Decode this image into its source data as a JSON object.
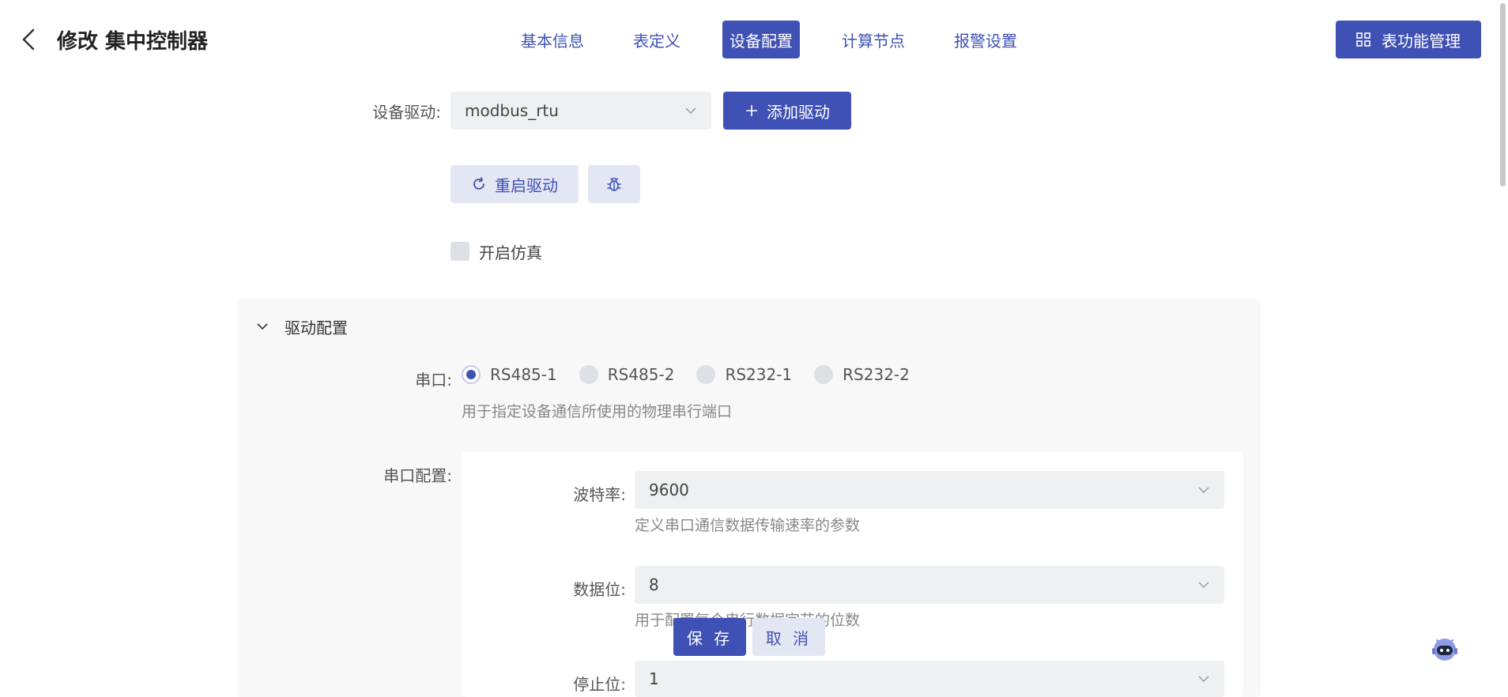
{
  "header": {
    "title": "修改 集中控制器",
    "tabs": [
      {
        "label": "基本信息"
      },
      {
        "label": "表定义"
      },
      {
        "label": "设备配置"
      },
      {
        "label": "计算节点"
      },
      {
        "label": "报警设置"
      }
    ],
    "active_tab": "设备配置",
    "function_button": "表功能管理"
  },
  "driver": {
    "label": "设备驱动:",
    "value": "modbus_rtu",
    "add_button": "添加驱动",
    "restart_button": "重启驱动",
    "debug_icon": "bug-icon"
  },
  "simulation": {
    "label": "开启仿真",
    "checked": false
  },
  "driver_config": {
    "title": "驱动配置",
    "serial_port": {
      "label": "串口:",
      "options": [
        "RS485-1",
        "RS485-2",
        "RS232-1",
        "RS232-2"
      ],
      "selected": "RS485-1",
      "hint": "用于指定设备通信所使用的物理串行端口"
    },
    "serial_config": {
      "label": "串口配置:",
      "baud_rate": {
        "label": "波特率:",
        "value": "9600",
        "hint": "定义串口通信数据传输速率的参数"
      },
      "data_bits": {
        "label": "数据位:",
        "value": "8",
        "hint": "用于配置每个串行数据字节的位数"
      },
      "stop_bits": {
        "label": "停止位:",
        "value": "1"
      }
    }
  },
  "actions": {
    "save": "保 存",
    "cancel": "取 消"
  },
  "colors": {
    "primary": "#3f51b5",
    "light_button": "#e3e6f3",
    "input_bg": "#eef0f2"
  }
}
